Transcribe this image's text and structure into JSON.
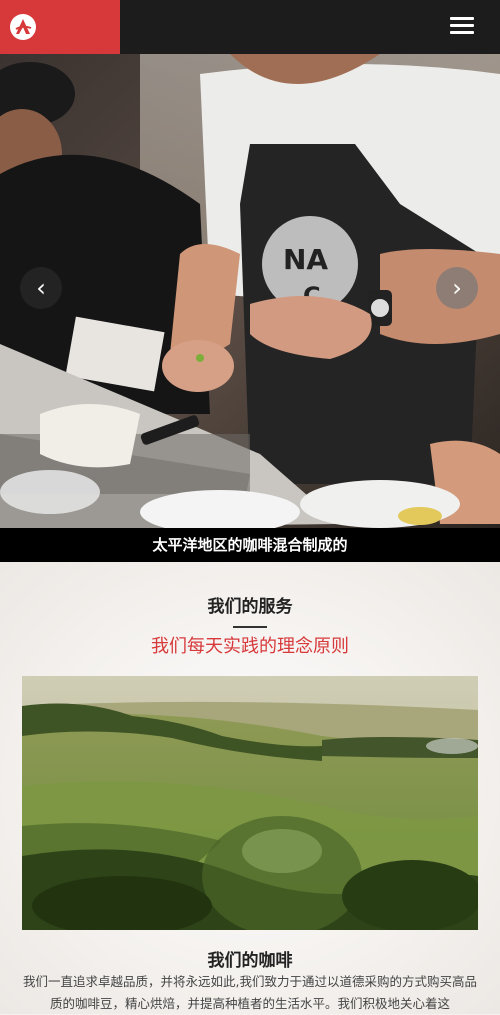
{
  "header": {
    "logo_icon": "brand-logo-icon",
    "menu_icon": "hamburger-menu-icon",
    "brand_color": "#d7393b"
  },
  "hero": {
    "caption": "太平洋地区的咖啡混合制成的",
    "prev_icon": "chevron-left-icon",
    "next_icon": "chevron-right-icon",
    "apron_text_1": "NA",
    "apron_text_2": "C"
  },
  "services": {
    "title": "我们的服务",
    "subtitle": "我们每天实践的理念原则"
  },
  "coffee": {
    "title": "我们的咖啡",
    "text": "我们一直追求卓越品质，并将永远如此,我们致力于通过以道德采购的方式购买高品质的咖啡豆，精心烘焙，并提高种植者的生活水平。我们积极地关心着这"
  }
}
